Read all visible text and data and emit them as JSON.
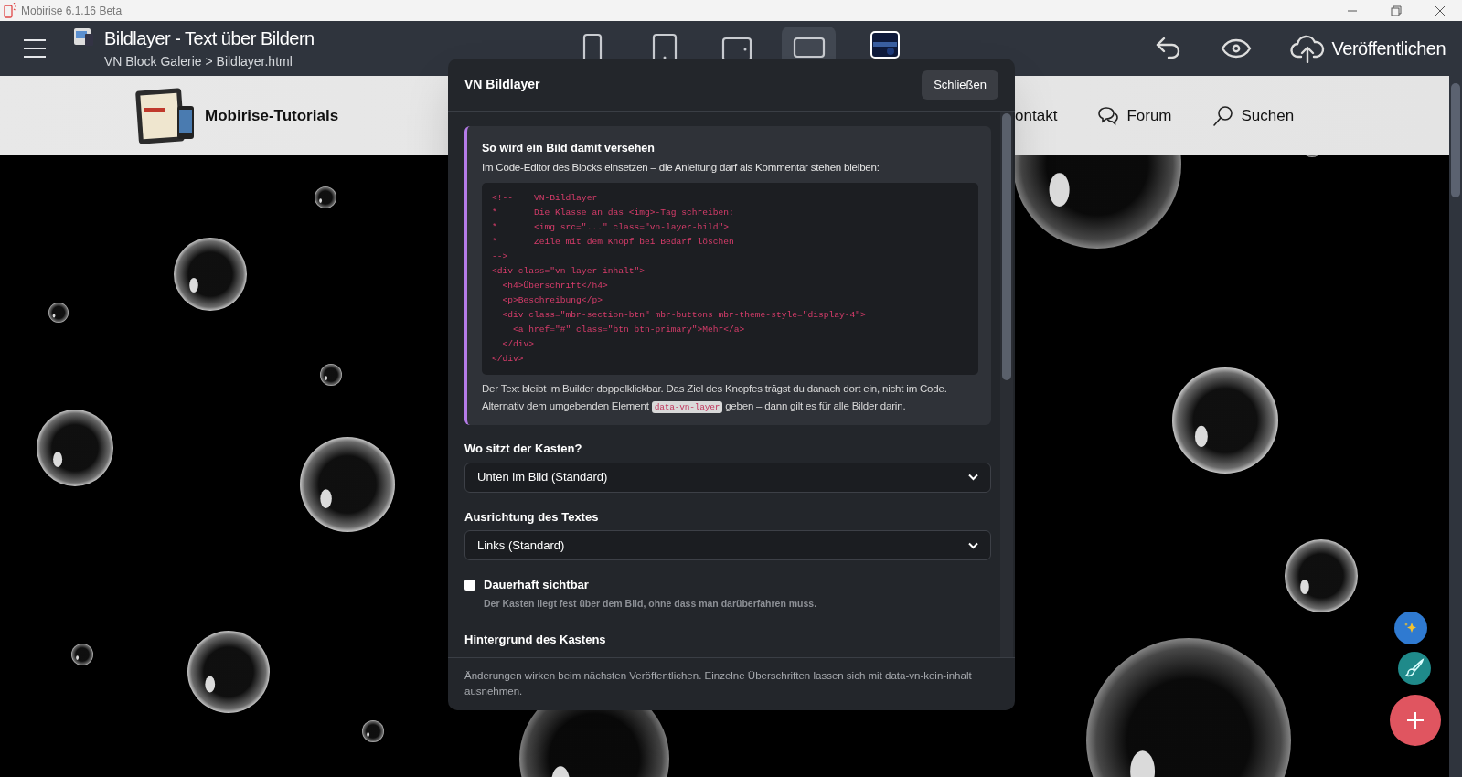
{
  "window": {
    "title": "Mobirise 6.1.16 Beta"
  },
  "toolbar": {
    "title": "Bildlayer - Text über Bildern",
    "breadcrumb": "VN Block Galerie > Bildlayer.html",
    "devices": [
      {
        "kind": "phone",
        "selected": false
      },
      {
        "kind": "tablet",
        "selected": false
      },
      {
        "kind": "tablet-landscape",
        "selected": false
      },
      {
        "kind": "desktop",
        "selected": true
      }
    ],
    "publish": "Veröffentlichen"
  },
  "site_nav": {
    "brand": "Mobirise-Tutorials",
    "items": [
      {
        "kind": "contact",
        "label": "ontakt"
      },
      {
        "kind": "forum",
        "label": "Forum"
      },
      {
        "kind": "search",
        "label": "Suchen"
      }
    ]
  },
  "dialog": {
    "title": "VN Bildlayer",
    "close": "Schließen",
    "info": {
      "heading": "So wird ein Bild damit versehen",
      "intro": "Im Code-Editor des Blocks einsetzen – die Anleitung darf als Kommentar stehen bleiben:",
      "code": [
        "<!--    VN-Bildlayer",
        "*       Die Klasse an das <img>-Tag schreiben:",
        "*       <img src=\"...\" class=\"vn-layer-bild\">",
        "*       Zeile mit dem Knopf bei Bedarf löschen",
        "-->",
        "<div class=\"vn-layer-inhalt\">",
        "  <h4>Überschrift</h4>",
        "  <p>Beschreibung</p>",
        "  <div class=\"mbr-section-btn\" mbr-buttons mbr-theme-style=\"display-4\">",
        "    <a href=\"#\" class=\"btn btn-primary\">Mehr</a>",
        "  </div>",
        "</div>"
      ],
      "note_before": "Der Text bleibt im Builder doppelklickbar. Das Ziel des Knopfes trägst du danach dort ein, nicht im Code. Alternativ dem umgebenden Element ",
      "note_code": "data-vn-layer",
      "note_after": " geben – dann gilt es für alle Bilder darin."
    },
    "fields": [
      {
        "kind": "select",
        "label": "Wo sitzt der Kasten?",
        "value": "Unten im Bild (Standard)"
      },
      {
        "kind": "select",
        "label": "Ausrichtung des Textes",
        "value": "Links (Standard)"
      },
      {
        "kind": "checkbox",
        "label": "Dauerhaft sichtbar",
        "hint": "Der Kasten liegt fest über dem Bild, ohne dass man darüberfahren muss.",
        "checked": false
      },
      {
        "kind": "heading",
        "label": "Hintergrund des Kastens"
      }
    ],
    "footer": "Änderungen wirken beim nächsten Veröffentlichen. Einzelne Überschriften lassen sich mit data-vn-kein-inhalt ausnehmen."
  }
}
